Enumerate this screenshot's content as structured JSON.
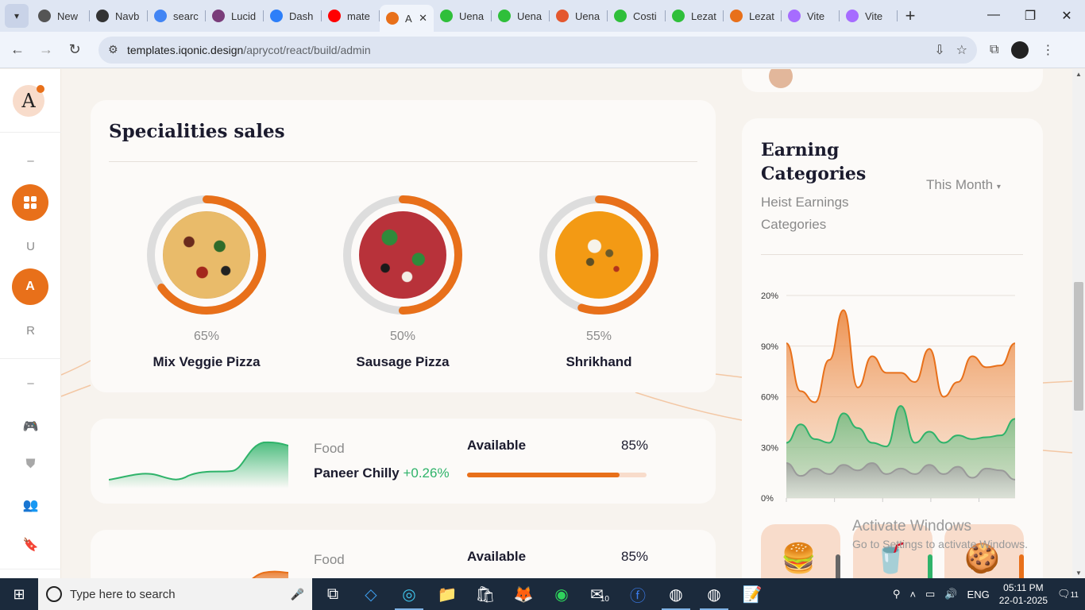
{
  "browser": {
    "tabs": [
      {
        "label": "New",
        "color": "#555555"
      },
      {
        "label": "Navb",
        "color": "#333333"
      },
      {
        "label": "searc",
        "color": "#4285f4"
      },
      {
        "label": "Lucid",
        "color": "#7a3d7a"
      },
      {
        "label": "Dash",
        "color": "#2d7ff9"
      },
      {
        "label": "mate",
        "color": "#ff0000"
      },
      {
        "label": "A",
        "color": "#e8701a",
        "active": true
      },
      {
        "label": "Uena",
        "color": "#2fbf3a"
      },
      {
        "label": "Uena",
        "color": "#2fbf3a"
      },
      {
        "label": "Uena",
        "color": "#e4572e"
      },
      {
        "label": "Costi",
        "color": "#2fbf3a"
      },
      {
        "label": "Lezat",
        "color": "#2fbf3a"
      },
      {
        "label": "Lezat",
        "color": "#e8701a"
      },
      {
        "label": "Vite",
        "color": "#a66cff"
      },
      {
        "label": "Vite",
        "color": "#a66cff"
      }
    ],
    "url_host": "templates.iqonic.design",
    "url_path": "/aprycot/react/build/admin"
  },
  "sidebar": {
    "logo_letter": "A",
    "items": [
      {
        "text": "–"
      },
      {
        "text": "U"
      },
      {
        "text": "A"
      },
      {
        "text": "R"
      },
      {
        "text": "–"
      }
    ]
  },
  "specialities": {
    "title": "Specialities sales",
    "items": [
      {
        "percent": 65,
        "percent_label": "65%",
        "name": "Mix Veggie Pizza",
        "kind": "pizza-veggie"
      },
      {
        "percent": 50,
        "percent_label": "50%",
        "name": "Sausage Pizza",
        "kind": "pizza-sausage"
      },
      {
        "percent": 55,
        "percent_label": "55%",
        "name": "Shrikhand",
        "kind": "shrikhand"
      }
    ]
  },
  "rows": [
    {
      "category": "Food",
      "name": "Paneer Chilly",
      "change": "+0.26%",
      "available_label": "Available",
      "value": "85%",
      "progress": 0.85,
      "color": "#2fb36a"
    },
    {
      "category": "Food",
      "name": "",
      "change": "",
      "available_label": "Available",
      "value": "85%",
      "progress": 0.85,
      "color": "#e8701a"
    }
  ],
  "earning": {
    "title": "Earning Categories",
    "subtitle": "Heist Earnings Categories",
    "period": "This Month",
    "chart_data": {
      "type": "area",
      "y_tick_labels": [
        "20%",
        "90%",
        "60%",
        "30%",
        "0%"
      ],
      "series": [
        {
          "color": "#e8701a",
          "values": [
            84,
            58,
            52,
            75,
            102,
            60,
            77,
            68,
            68,
            63,
            81,
            55,
            63,
            77,
            71,
            72,
            84
          ]
        },
        {
          "color": "#2fb36a",
          "values": [
            30,
            40,
            32,
            30,
            46,
            38,
            30,
            28,
            50,
            30,
            36,
            30,
            34,
            32,
            33,
            34,
            43
          ]
        },
        {
          "color": "#9a9a9a",
          "values": [
            19,
            12,
            16,
            13,
            18,
            15,
            19,
            13,
            16,
            13,
            18,
            13,
            17,
            11,
            16,
            15,
            10
          ]
        }
      ]
    },
    "mini_cards": [
      {
        "icon": "🍔",
        "accent": "#666666"
      },
      {
        "icon": "🥤",
        "accent": "#2fb36a"
      },
      {
        "icon": "🍪",
        "accent": "#e8701a"
      }
    ]
  },
  "watermark": {
    "line1": "Activate Windows",
    "line2": "Go to Settings to activate Windows."
  },
  "taskbar": {
    "search_placeholder": "Type here to search",
    "language": "ENG",
    "time": "05:11 PM",
    "date": "22-01-2025",
    "notifications": "11",
    "mail_badge": "10"
  }
}
